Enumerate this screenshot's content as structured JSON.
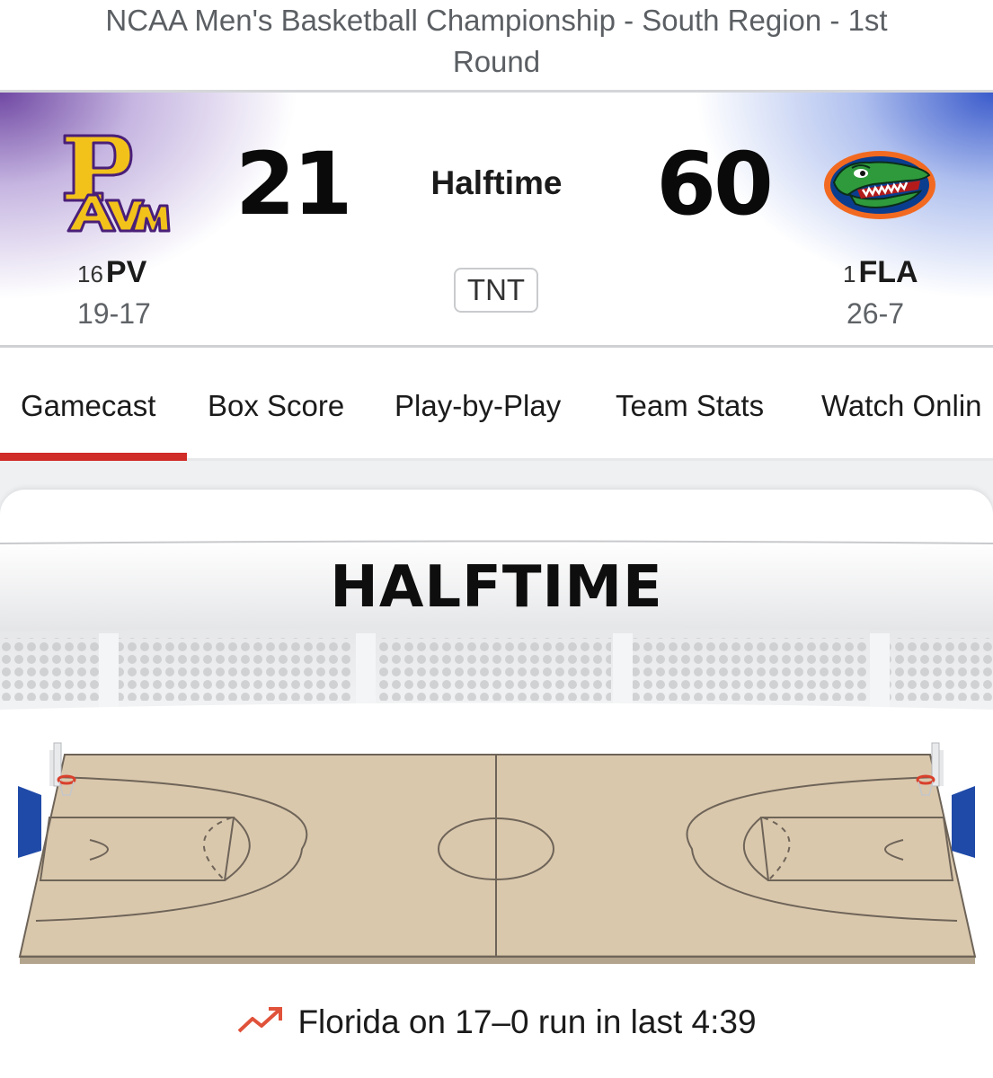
{
  "event": {
    "title": "NCAA Men's Basketball Championship - South Region - 1st Round"
  },
  "scoreboard": {
    "status": "Halftime",
    "network": "TNT",
    "away": {
      "seed": "16",
      "abbr": "PV",
      "record": "19-17",
      "score": "21",
      "logo": "PVAM-logo",
      "color": "#5b2d8e"
    },
    "home": {
      "seed": "1",
      "abbr": "FLA",
      "record": "26-7",
      "score": "60",
      "logo": "gator-logo",
      "color": "#0b42a6"
    }
  },
  "tabs": [
    {
      "label": "Gamecast",
      "active": true
    },
    {
      "label": "Box Score"
    },
    {
      "label": "Play-by-Play"
    },
    {
      "label": "Team Stats"
    },
    {
      "label": "Watch Onlin"
    }
  ],
  "gamecast": {
    "status": "HALFTIME",
    "run_text": "Florida on 17–0 run in last 4:39",
    "run_icon": "trending-up-icon"
  },
  "colors": {
    "accent": "#d02c28",
    "court": "#dac8ad",
    "stand_blue": "#1f4aa8"
  }
}
